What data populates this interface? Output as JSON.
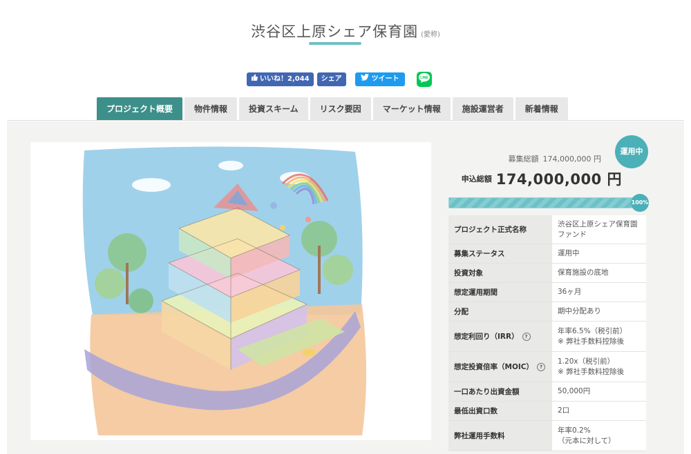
{
  "header": {
    "title": "渋谷区上原シェア保育園",
    "title_note": "(愛称)"
  },
  "social": {
    "like_label": "いいね！2,044",
    "share_label": "シェア",
    "tweet_label": "ツイート",
    "line_label": "LINE"
  },
  "tabs": [
    {
      "label": "プロジェクト概要",
      "active": true
    },
    {
      "label": "物件情報"
    },
    {
      "label": "投資スキーム"
    },
    {
      "label": "リスク要因"
    },
    {
      "label": "マーケット情報"
    },
    {
      "label": "施設運営者"
    },
    {
      "label": "新着情報"
    }
  ],
  "funding": {
    "status_badge": "運用中",
    "goal_label": "募集総額",
    "goal_value": "174,000,000 円",
    "applied_label": "申込総額",
    "applied_value": "174,000,000 円",
    "progress_percent": 100,
    "progress_label": "100%"
  },
  "details": [
    {
      "key": "プロジェクト正式名称",
      "value": "渋谷区上原シェア保育園ファンド"
    },
    {
      "key": "募集ステータス",
      "value": "運用中"
    },
    {
      "key": "投資対象",
      "value": "保育施設の底地"
    },
    {
      "key": "想定運用期間",
      "value": "36ヶ月"
    },
    {
      "key": "分配",
      "value": "期中分配あり"
    },
    {
      "key": "想定利回り（IRR）",
      "value": "年率6.5%（税引前）",
      "note": "※ 弊社手数料控除後"
    },
    {
      "key": "想定投資倍率（MOIC）",
      "value": "1.20x（税引前）",
      "note": "※ 弊社手数料控除後"
    },
    {
      "key": "一口あたり出資金額",
      "value": "50,000円"
    },
    {
      "key": "最低出資口数",
      "value": "2口"
    },
    {
      "key": "弊社運用手数料",
      "value": "年率0.2%",
      "note": "（元本に対して）"
    }
  ],
  "colors": {
    "accent": "#3d8f8a",
    "badge": "#4bb0b7",
    "facebook": "#4267b2",
    "twitter": "#1d9bf0",
    "line": "#06c755"
  },
  "icons": {
    "like": "thumbs-up-icon",
    "tweet": "twitter-bird-icon",
    "line": "line-icon",
    "help": "question-circle-icon"
  }
}
